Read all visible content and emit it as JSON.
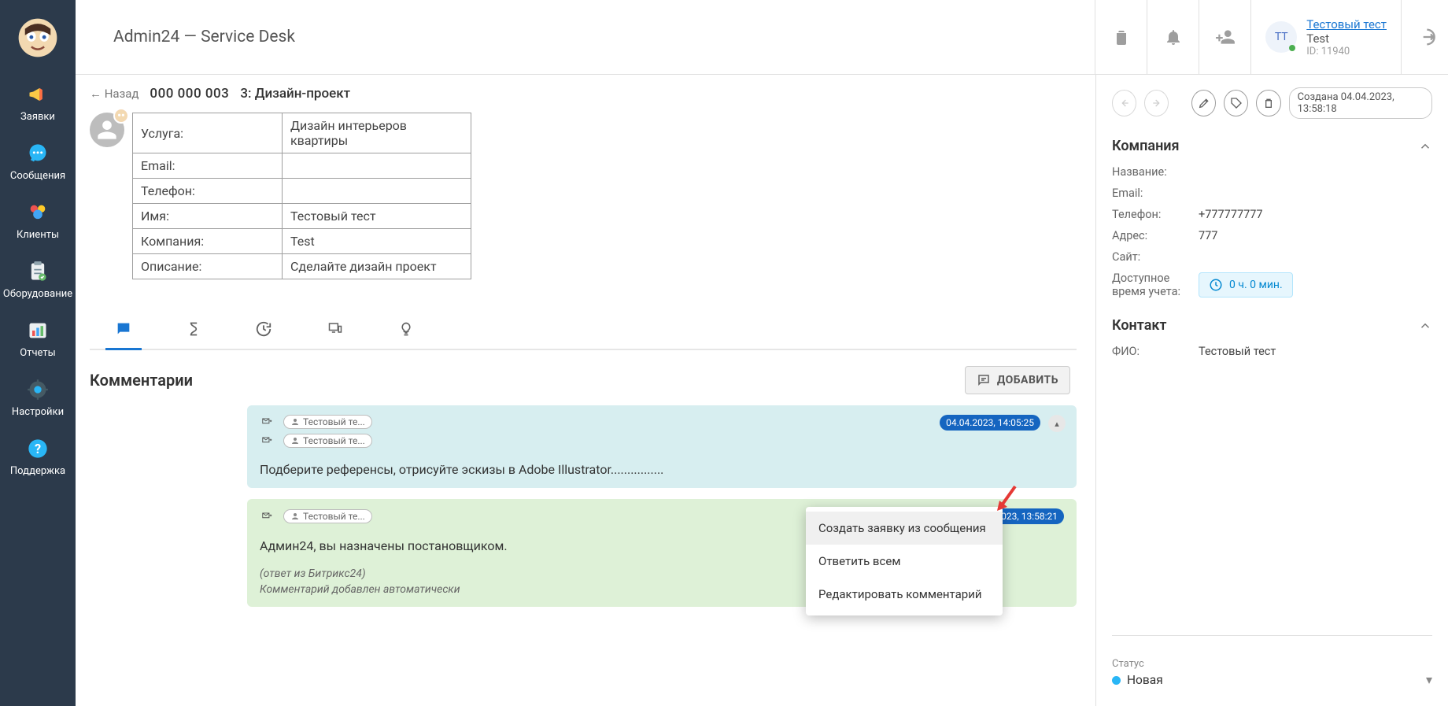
{
  "app": {
    "title": "Admin24 — Service Desk"
  },
  "nav": {
    "items": [
      {
        "label": "Заявки"
      },
      {
        "label": "Сообщения"
      },
      {
        "label": "Клиенты"
      },
      {
        "label": "Оборудование"
      },
      {
        "label": "Отчеты"
      },
      {
        "label": "Настройки"
      },
      {
        "label": "Поддержка"
      }
    ]
  },
  "header": {
    "user": {
      "initials": "ТТ",
      "name_link": "Тестовый тест",
      "org": "Test",
      "id_label": "ID: 11940"
    }
  },
  "ticket": {
    "back": "← Назад",
    "id": "000 000 003",
    "title": "3: Дизайн-проект",
    "fields": [
      {
        "k": "Услуга:",
        "v": "Дизайн интерьеров квартиры"
      },
      {
        "k": "Email:",
        "v": ""
      },
      {
        "k": "Телефон:",
        "v": ""
      },
      {
        "k": "Имя:",
        "v": "Тестовый тест"
      },
      {
        "k": "Компания:",
        "v": "Test"
      },
      {
        "k": "Описание:",
        "v": "Сделайте дизайн проект"
      }
    ]
  },
  "comments": {
    "heading": "Комментарии",
    "add_label": "ДОБАВИТЬ",
    "items": [
      {
        "color": "blue",
        "users": [
          "Тестовый те...",
          "Тестовый те..."
        ],
        "date": "04.04.2023, 14:05:25",
        "body": "Подберите референсы, отрисуйте эскизы в Adobe Illustrator................",
        "menu_open": true
      },
      {
        "color": "green",
        "users": [
          "Тестовый те..."
        ],
        "date": "04.04.2023, 13:58:21",
        "body": "Админ24, вы назначены постановщиком.",
        "note1": "(ответ из Битрикс24)",
        "note2": "Комментарий добавлен автоматически"
      }
    ],
    "context_menu": [
      "Создать заявку из сообщения",
      "Ответить всем",
      "Редактировать комментарий"
    ]
  },
  "right": {
    "created": "Создана 04.04.2023, 13:58:18",
    "company": {
      "heading": "Компания",
      "rows": {
        "name_k": "Название:",
        "email_k": "Email:",
        "phone_k": "Телефон:",
        "phone_v": "+777777777",
        "addr_k": "Адрес:",
        "addr_v": "777",
        "site_k": "Сайт:",
        "time_k": "Доступное время учета:",
        "time_v": "0 ч. 0 мин."
      }
    },
    "contact": {
      "heading": "Контакт",
      "rows": {
        "fio_k": "ФИО:",
        "fio_v": "Тестовый тест"
      }
    },
    "status": {
      "label": "Статус",
      "value": "Новая"
    }
  }
}
